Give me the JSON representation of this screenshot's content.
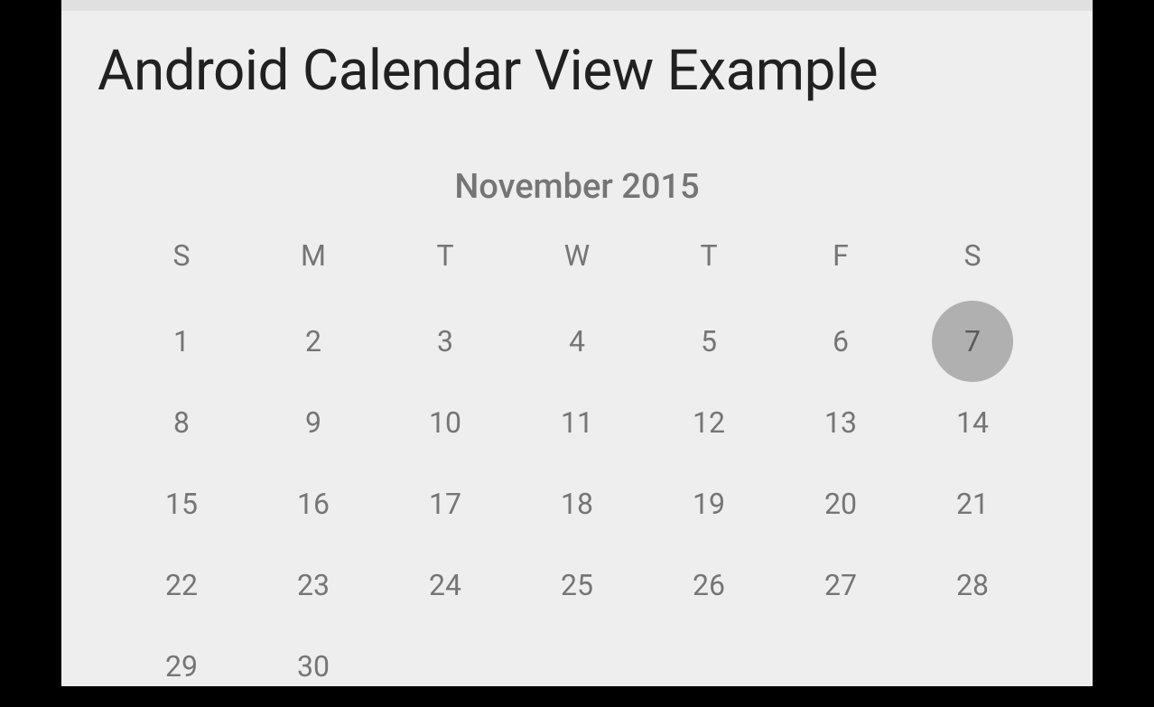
{
  "header": {
    "title": "Android Calendar View Example"
  },
  "calendar": {
    "month_label": "November 2015",
    "weekdays": [
      "S",
      "M",
      "T",
      "W",
      "T",
      "F",
      "S"
    ],
    "selected_day": 7,
    "weeks": [
      [
        1,
        2,
        3,
        4,
        5,
        6,
        7
      ],
      [
        8,
        9,
        10,
        11,
        12,
        13,
        14
      ],
      [
        15,
        16,
        17,
        18,
        19,
        20,
        21
      ],
      [
        22,
        23,
        24,
        25,
        26,
        27,
        28
      ],
      [
        29,
        30,
        null,
        null,
        null,
        null,
        null
      ]
    ]
  }
}
